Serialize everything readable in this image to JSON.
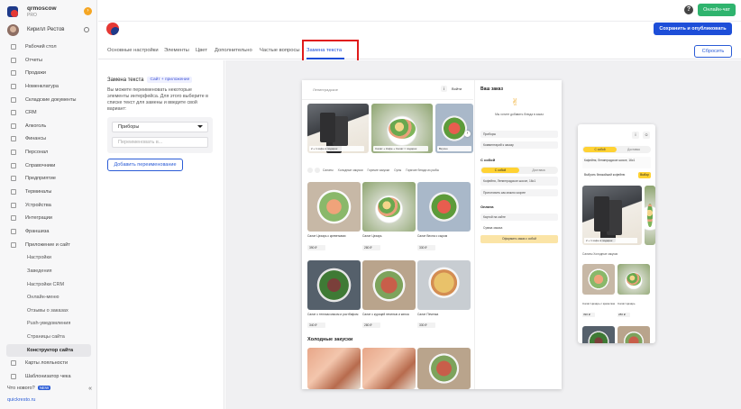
{
  "brand": {
    "name": "qrmoscow",
    "plan": "PRO"
  },
  "user": {
    "name": "Кирилл Рестов"
  },
  "nav": [
    {
      "label": "Рабочий стол",
      "sub": false,
      "active": false,
      "icon": "dashboard-icon"
    },
    {
      "label": "Отчеты",
      "sub": false,
      "active": false,
      "icon": "reports-icon"
    },
    {
      "label": "Продажи",
      "sub": false,
      "active": false,
      "icon": "sales-icon"
    },
    {
      "label": "Номенклатура",
      "sub": false,
      "active": false,
      "icon": "catalog-icon"
    },
    {
      "label": "Складские документы",
      "sub": false,
      "active": false,
      "icon": "warehouse-icon"
    },
    {
      "label": "CRM",
      "sub": false,
      "active": false,
      "icon": "crm-icon"
    },
    {
      "label": "Алкоголь",
      "sub": false,
      "active": false,
      "icon": "alcohol-icon"
    },
    {
      "label": "Финансы",
      "sub": false,
      "active": false,
      "icon": "finance-icon"
    },
    {
      "label": "Персонал",
      "sub": false,
      "active": false,
      "icon": "staff-icon"
    },
    {
      "label": "Справочники",
      "sub": false,
      "active": false,
      "icon": "book-icon"
    },
    {
      "label": "Предприятие",
      "sub": false,
      "active": false,
      "icon": "company-icon"
    },
    {
      "label": "Терминалы",
      "sub": false,
      "active": false,
      "icon": "terminal-icon"
    },
    {
      "label": "Устройства",
      "sub": false,
      "active": false,
      "icon": "device-icon"
    },
    {
      "label": "Интеграции",
      "sub": false,
      "active": false,
      "icon": "integration-icon"
    },
    {
      "label": "Франшиза",
      "sub": false,
      "active": false,
      "icon": "franchise-icon"
    },
    {
      "label": "Приложение и сайт",
      "sub": false,
      "active": false,
      "icon": "app-icon"
    },
    {
      "label": "Настройки",
      "sub": true,
      "active": false,
      "icon": ""
    },
    {
      "label": "Заведения",
      "sub": true,
      "active": false,
      "icon": ""
    },
    {
      "label": "Настройки CRM",
      "sub": true,
      "active": false,
      "icon": ""
    },
    {
      "label": "Онлайн-меню",
      "sub": true,
      "active": false,
      "icon": ""
    },
    {
      "label": "Отзывы о заказах",
      "sub": true,
      "active": false,
      "icon": ""
    },
    {
      "label": "Push-уведомления",
      "sub": true,
      "active": false,
      "icon": ""
    },
    {
      "label": "Страницы сайта",
      "sub": true,
      "active": false,
      "icon": ""
    },
    {
      "label": "Конструктор сайта",
      "sub": true,
      "active": true,
      "icon": ""
    },
    {
      "label": "Карты лояльности",
      "sub": false,
      "active": false,
      "icon": "loyalty-icon"
    },
    {
      "label": "Шаблонизатор чека",
      "sub": false,
      "active": false,
      "icon": "receipt-icon"
    }
  ],
  "footer": {
    "whats_new": "Что нового?",
    "new_badge": "NEW",
    "collapse": "«",
    "link": "quickresto.ru"
  },
  "topbar": {
    "help": "?",
    "chat": "Онлайн-чат"
  },
  "header": {
    "publish": "Сохранить и опубликовать",
    "reset": "Сбросить"
  },
  "tabs": [
    "Основные настройки",
    "Элементы",
    "Цвет",
    "Дополнительно",
    "Частые вопросы",
    "Замена текста"
  ],
  "panel": {
    "title": "Замена текста",
    "chip": "Сайт + приложение",
    "desc": "Вы можете переименовать некоторые элементы интерфейса. Для этого выберите в списке текст для замены и введите свой вариант:",
    "select_value": "Приборы",
    "input_placeholder": "Переименовать в...",
    "add_button": "Добавить переименование"
  },
  "preview": {
    "address": "Ленинградское",
    "info": "i",
    "login": "Войти",
    "captions": [
      "2 + 1 кофе в подарок",
      "Салат + Кофе + Салат = подарок",
      "Вкусно"
    ],
    "cats": [
      "Салаты",
      "Холодные закуски",
      "Горячие закуски",
      "Супы",
      "Горячие блюда из рыбы"
    ],
    "dishes": [
      {
        "name": "Салат Цезарь с креветками",
        "price": "390 ₽"
      },
      {
        "name": "Салат Цезарь",
        "price": "280 ₽"
      },
      {
        "name": "Салат Весна с сыром",
        "price": "330 ₽"
      },
      {
        "name": "Салат с теплым мясом и ростбифом",
        "price": "340 ₽"
      },
      {
        "name": "Салат с курицей печенью и киноа",
        "price": "280 ₽"
      },
      {
        "name": "Салат Печенка",
        "price": "330 ₽"
      }
    ],
    "section": "Холодные закуски",
    "cart": {
      "title": "Ваш заказ",
      "empty": "Мы хотите добавить блюда в заказ",
      "devices": "Приборы",
      "comment": "Комментарий к заказу",
      "self_label": "С собой",
      "self_on": "С собой",
      "self_off": "Доставка",
      "place": "Кофейня, Ленинградское шоссе, 16с1",
      "time": "Приготовить как можно скорее",
      "pay_label": "Оплата",
      "pay_method": "Картой на сайте",
      "total": "Сумма заказа",
      "submit": "Оформить заказ с собой"
    }
  },
  "mobile": {
    "info": "i",
    "self_on": "С собой",
    "self_off": "Доставка",
    "place": "Кофейня, Ленинградское шоссе, 16с1",
    "pick": "Выбрать ближайший кофейню",
    "pick_btn": "Выбор",
    "caption": "2 + 1 кофе в подарок",
    "cats": "Салаты   Холодные закуски",
    "dishes": [
      {
        "name": "Салат Цезарь с креветками",
        "price": "390 ₽"
      },
      {
        "name": "Салат Цезарь",
        "price": "280 ₽"
      }
    ]
  }
}
